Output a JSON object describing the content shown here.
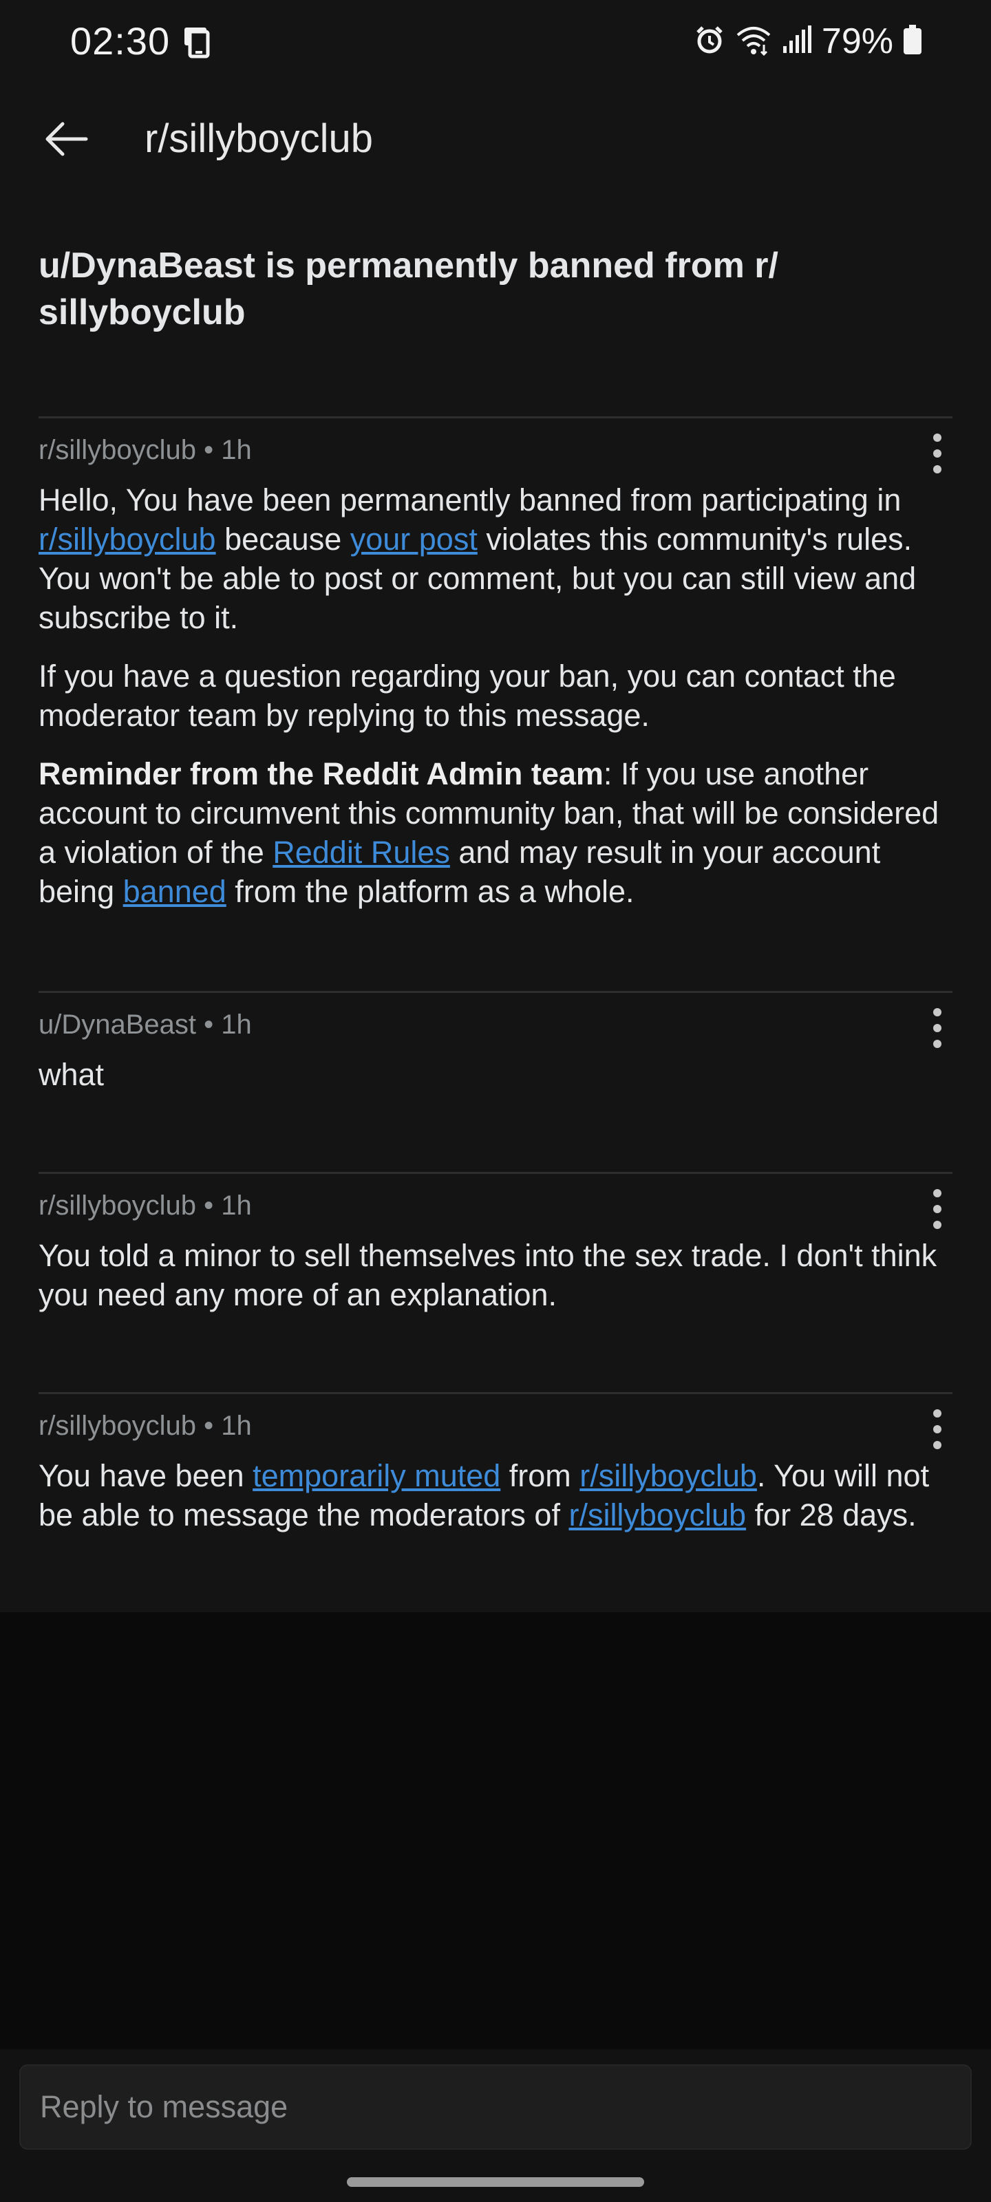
{
  "status_bar": {
    "time": "02:30",
    "battery": "79%",
    "icons": [
      "notification-icon",
      "alarm-icon",
      "wifi-icon",
      "signal-icon",
      "battery-icon"
    ]
  },
  "header": {
    "title": "r/sillyboyclub",
    "back_icon": "arrow-left-icon"
  },
  "subject": "u/DynaBeast is permanently banned from r/ sillyboyclub",
  "messages": [
    {
      "meta": "r/sillyboyclub • 1h",
      "p1_a": "Hello, You have been permanently banned from participating in ",
      "p1_link1": "r/sillyboyclub",
      "p1_b": " because ",
      "p1_link2": "your post",
      "p1_c": " violates this community's rules. You won't be able to post or comment, but you can still view and subscribe to it.",
      "p2": "If you have a question regarding your ban, you can contact the moderator team by replying to this message.",
      "p3_bold": "Reminder from the Reddit Admin team",
      "p3_a": ": If you use another account to circumvent this community ban, that will be considered a violation of the ",
      "p3_link1": "Reddit Rules",
      "p3_b": " and may result in your account being ",
      "p3_link2": "banned",
      "p3_c": " from the platform as a whole."
    },
    {
      "meta": "u/DynaBeast • 1h",
      "body": "what"
    },
    {
      "meta": "r/sillyboyclub • 1h",
      "body": "You told a minor to sell themselves into the sex trade. I don't think you need any more of an explanation."
    },
    {
      "meta": "r/sillyboyclub • 1h",
      "a": "You have been ",
      "link1": "temporarily muted",
      "b": " from ",
      "link2": "r/sillyboyclub",
      "c": ". You will not be able to message the moderators of ",
      "link3": "r/sillyboyclub",
      "d": " for 28 days."
    }
  ],
  "reply": {
    "placeholder": "Reply to message"
  },
  "colors": {
    "background": "#141414",
    "link": "#3d8bd9",
    "meta": "#8f9294",
    "text": "#e4e6e8"
  }
}
